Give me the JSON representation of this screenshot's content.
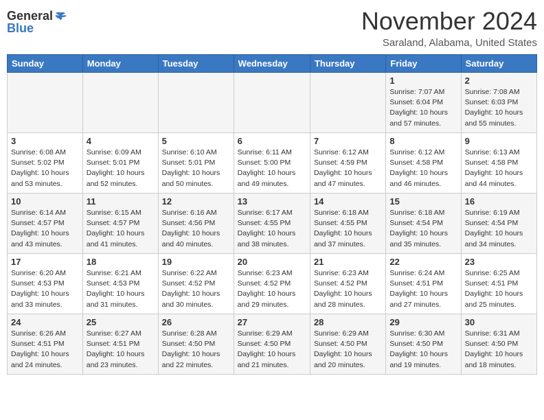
{
  "header": {
    "logo_general": "General",
    "logo_blue": "Blue",
    "month_title": "November 2024",
    "location": "Saraland, Alabama, United States"
  },
  "weekdays": [
    "Sunday",
    "Monday",
    "Tuesday",
    "Wednesday",
    "Thursday",
    "Friday",
    "Saturday"
  ],
  "weeks": [
    [
      {
        "day": "",
        "info": ""
      },
      {
        "day": "",
        "info": ""
      },
      {
        "day": "",
        "info": ""
      },
      {
        "day": "",
        "info": ""
      },
      {
        "day": "",
        "info": ""
      },
      {
        "day": "1",
        "info": "Sunrise: 7:07 AM\nSunset: 6:04 PM\nDaylight: 10 hours and 57 minutes."
      },
      {
        "day": "2",
        "info": "Sunrise: 7:08 AM\nSunset: 6:03 PM\nDaylight: 10 hours and 55 minutes."
      }
    ],
    [
      {
        "day": "3",
        "info": "Sunrise: 6:08 AM\nSunset: 5:02 PM\nDaylight: 10 hours and 53 minutes."
      },
      {
        "day": "4",
        "info": "Sunrise: 6:09 AM\nSunset: 5:01 PM\nDaylight: 10 hours and 52 minutes."
      },
      {
        "day": "5",
        "info": "Sunrise: 6:10 AM\nSunset: 5:01 PM\nDaylight: 10 hours and 50 minutes."
      },
      {
        "day": "6",
        "info": "Sunrise: 6:11 AM\nSunset: 5:00 PM\nDaylight: 10 hours and 49 minutes."
      },
      {
        "day": "7",
        "info": "Sunrise: 6:12 AM\nSunset: 4:59 PM\nDaylight: 10 hours and 47 minutes."
      },
      {
        "day": "8",
        "info": "Sunrise: 6:12 AM\nSunset: 4:58 PM\nDaylight: 10 hours and 46 minutes."
      },
      {
        "day": "9",
        "info": "Sunrise: 6:13 AM\nSunset: 4:58 PM\nDaylight: 10 hours and 44 minutes."
      }
    ],
    [
      {
        "day": "10",
        "info": "Sunrise: 6:14 AM\nSunset: 4:57 PM\nDaylight: 10 hours and 43 minutes."
      },
      {
        "day": "11",
        "info": "Sunrise: 6:15 AM\nSunset: 4:57 PM\nDaylight: 10 hours and 41 minutes."
      },
      {
        "day": "12",
        "info": "Sunrise: 6:16 AM\nSunset: 4:56 PM\nDaylight: 10 hours and 40 minutes."
      },
      {
        "day": "13",
        "info": "Sunrise: 6:17 AM\nSunset: 4:55 PM\nDaylight: 10 hours and 38 minutes."
      },
      {
        "day": "14",
        "info": "Sunrise: 6:18 AM\nSunset: 4:55 PM\nDaylight: 10 hours and 37 minutes."
      },
      {
        "day": "15",
        "info": "Sunrise: 6:18 AM\nSunset: 4:54 PM\nDaylight: 10 hours and 35 minutes."
      },
      {
        "day": "16",
        "info": "Sunrise: 6:19 AM\nSunset: 4:54 PM\nDaylight: 10 hours and 34 minutes."
      }
    ],
    [
      {
        "day": "17",
        "info": "Sunrise: 6:20 AM\nSunset: 4:53 PM\nDaylight: 10 hours and 33 minutes."
      },
      {
        "day": "18",
        "info": "Sunrise: 6:21 AM\nSunset: 4:53 PM\nDaylight: 10 hours and 31 minutes."
      },
      {
        "day": "19",
        "info": "Sunrise: 6:22 AM\nSunset: 4:52 PM\nDaylight: 10 hours and 30 minutes."
      },
      {
        "day": "20",
        "info": "Sunrise: 6:23 AM\nSunset: 4:52 PM\nDaylight: 10 hours and 29 minutes."
      },
      {
        "day": "21",
        "info": "Sunrise: 6:23 AM\nSunset: 4:52 PM\nDaylight: 10 hours and 28 minutes."
      },
      {
        "day": "22",
        "info": "Sunrise: 6:24 AM\nSunset: 4:51 PM\nDaylight: 10 hours and 27 minutes."
      },
      {
        "day": "23",
        "info": "Sunrise: 6:25 AM\nSunset: 4:51 PM\nDaylight: 10 hours and 25 minutes."
      }
    ],
    [
      {
        "day": "24",
        "info": "Sunrise: 6:26 AM\nSunset: 4:51 PM\nDaylight: 10 hours and 24 minutes."
      },
      {
        "day": "25",
        "info": "Sunrise: 6:27 AM\nSunset: 4:51 PM\nDaylight: 10 hours and 23 minutes."
      },
      {
        "day": "26",
        "info": "Sunrise: 6:28 AM\nSunset: 4:50 PM\nDaylight: 10 hours and 22 minutes."
      },
      {
        "day": "27",
        "info": "Sunrise: 6:29 AM\nSunset: 4:50 PM\nDaylight: 10 hours and 21 minutes."
      },
      {
        "day": "28",
        "info": "Sunrise: 6:29 AM\nSunset: 4:50 PM\nDaylight: 10 hours and 20 minutes."
      },
      {
        "day": "29",
        "info": "Sunrise: 6:30 AM\nSunset: 4:50 PM\nDaylight: 10 hours and 19 minutes."
      },
      {
        "day": "30",
        "info": "Sunrise: 6:31 AM\nSunset: 4:50 PM\nDaylight: 10 hours and 18 minutes."
      }
    ]
  ]
}
